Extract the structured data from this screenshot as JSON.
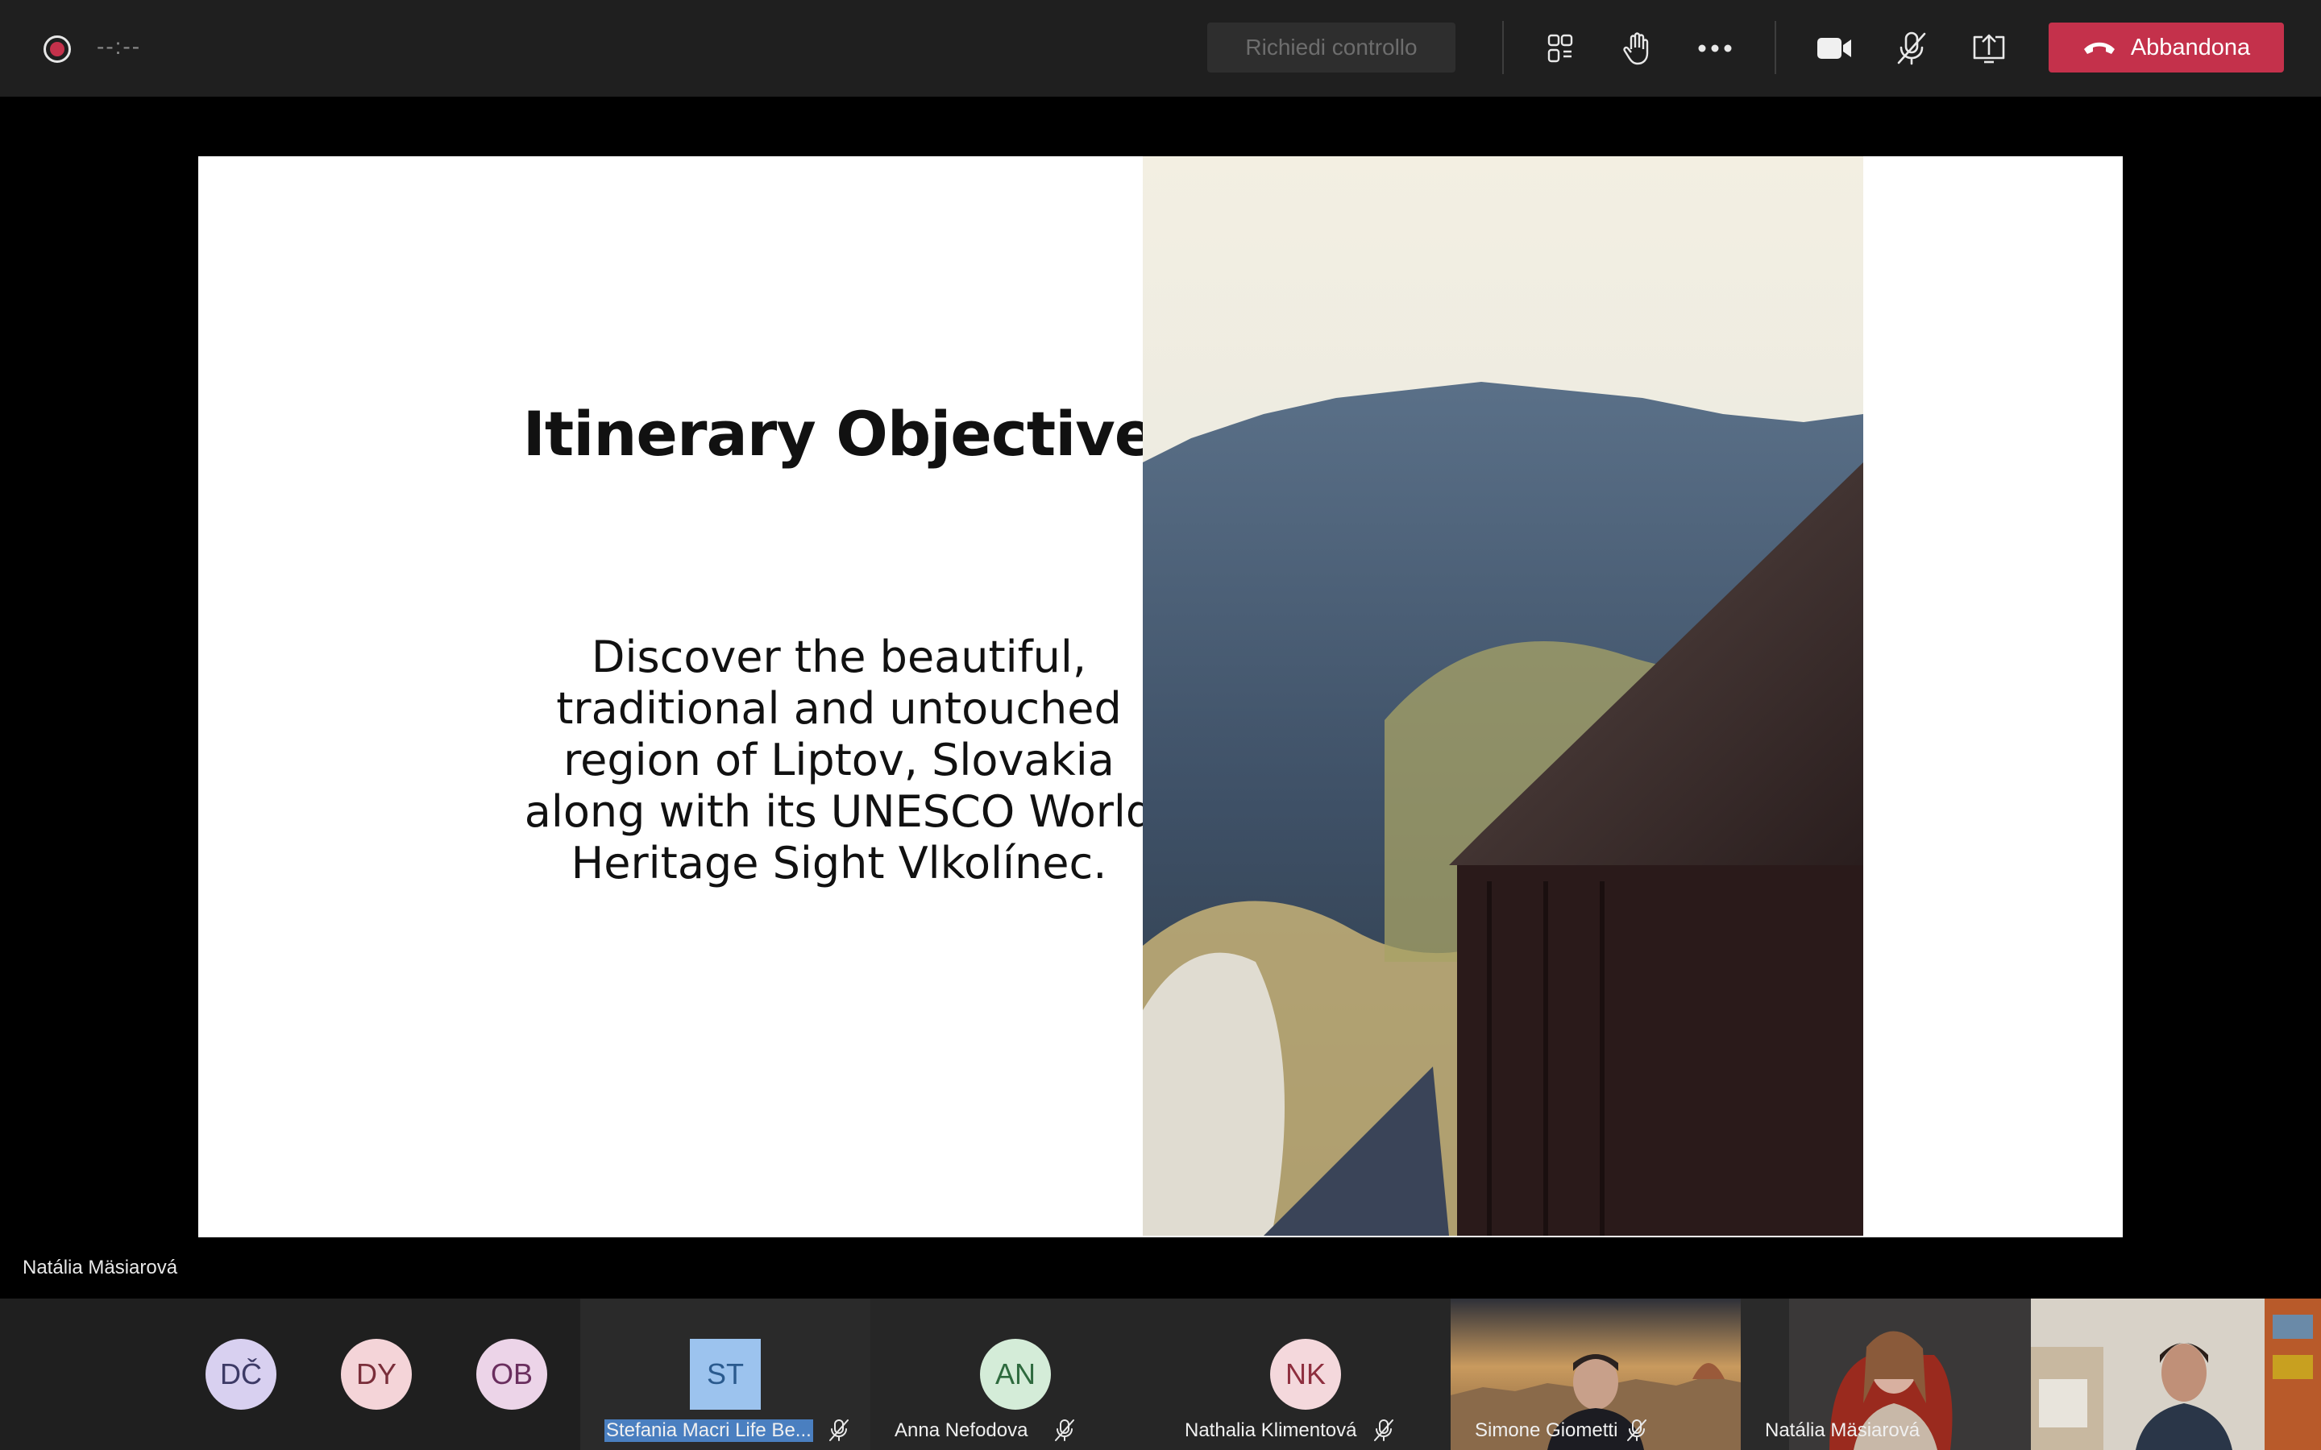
{
  "toolbar": {
    "timer": "--:--",
    "request_control_label": "Richiedi controllo",
    "leave_label": "Abbandona",
    "icons": [
      "participants-icon",
      "raise-hand-icon",
      "more-options-icon",
      "camera-icon",
      "mic-off-icon",
      "share-screen-icon",
      "phone-hangup-icon"
    ],
    "leave_color": "#c4314b"
  },
  "slide": {
    "title": "Itinerary Objective",
    "body_lines": [
      "Discover the beautiful,",
      "traditional and untouched",
      "region of Liptov, Slovakia",
      "along with its UNESCO World",
      "Heritage Sight Vlkolínec."
    ]
  },
  "presenter": {
    "name": "Natália Mäsiarová"
  },
  "participants": [
    {
      "initials": "DČ",
      "bg": "#d8d0f0",
      "fg": "#3d3a66"
    },
    {
      "initials": "DY",
      "bg": "#f4d4d8",
      "fg": "#7a2e3a"
    },
    {
      "initials": "OB",
      "bg": "#ecd4e8",
      "fg": "#6a2e5e"
    },
    {
      "initials": "ST",
      "name": "Stefania Macri Life Be...",
      "bg": "#9cc3ee",
      "fg": "#2a5a8e",
      "muted": true
    },
    {
      "initials": "AN",
      "name": "Anna Nefodova",
      "bg": "#d4ecd8",
      "fg": "#2e6a3e",
      "muted": true
    },
    {
      "initials": "NK",
      "name": "Nathalia Klimentová",
      "bg": "#f4d8dc",
      "fg": "#8e2e3e",
      "muted": true
    }
  ],
  "video_participants": [
    {
      "name": "Simone Giometti",
      "muted": true
    },
    {
      "name": "Natália Mäsiarová",
      "muted": false
    },
    {
      "name": "",
      "muted": false
    }
  ]
}
